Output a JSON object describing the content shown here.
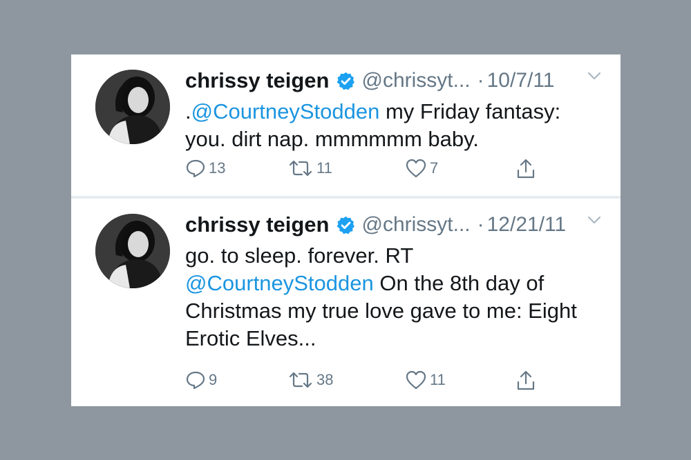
{
  "tweets": [
    {
      "author": "chrissy teigen",
      "handle": "@chrissyt...",
      "separator": "·",
      "date": "10/7/11",
      "text_prefix": ".",
      "mention": "@CourtneyStodden",
      "text_suffix": " my Friday fantasy: you. dirt nap. mmmmmm baby.",
      "text_before_mention": "",
      "replies": "13",
      "retweets": "11",
      "likes": "7"
    },
    {
      "author": "chrissy teigen",
      "handle": "@chrissyt...",
      "separator": "·",
      "date": "12/21/11",
      "text_before_mention": "go. to sleep. forever. RT ",
      "text_prefix": "",
      "mention": "@CourtneyStodden",
      "text_suffix": " On the 8th day of Christmas my true love gave to me: Eight Erotic Elves...",
      "replies": "9",
      "retweets": "38",
      "likes": "11"
    }
  ],
  "icons": {
    "verified": "verified-badge-icon",
    "menu": "chevron-down-icon",
    "reply": "reply-icon",
    "retweet": "retweet-icon",
    "like": "heart-icon",
    "share": "share-icon"
  },
  "colors": {
    "background": "#8e979f",
    "card": "#ffffff",
    "mention": "#1b95e0",
    "verified": "#1da1f2",
    "secondary_text": "#657786",
    "primary_text": "#14171a"
  }
}
